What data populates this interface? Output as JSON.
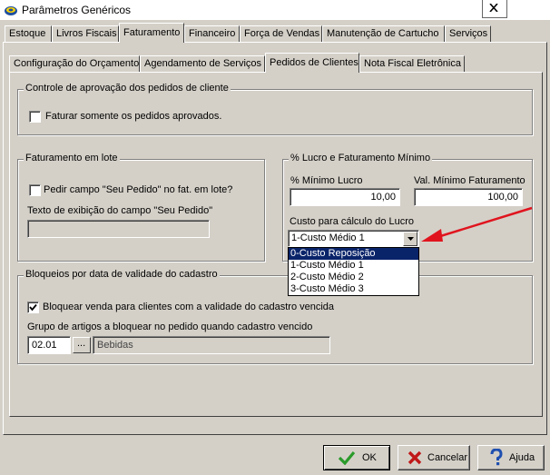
{
  "window": {
    "title": "Parâmetros Genéricos",
    "close_glyph": "X",
    "icon": "app-icon"
  },
  "main_tabs": [
    {
      "label": "Estoque"
    },
    {
      "label": "Livros Fiscais"
    },
    {
      "label": "Faturamento"
    },
    {
      "label": "Financeiro"
    },
    {
      "label": "Força de Vendas"
    },
    {
      "label": "Manutenção de Cartucho"
    },
    {
      "label": "Serviços"
    }
  ],
  "sub_tabs": [
    {
      "label": "Configuração do Orçamento"
    },
    {
      "label": "Agendamento de Serviços"
    },
    {
      "label": "Pedidos de Clientes"
    },
    {
      "label": "Nota Fiscal Eletrônica"
    }
  ],
  "approval_group": {
    "title": "Controle de aprovação dos pedidos de cliente",
    "checkbox_label": "Faturar somente os pedidos aprovados.",
    "checked": false
  },
  "batch_group": {
    "title": "Faturamento em lote",
    "checkbox_label": "Pedir campo \"Seu Pedido\" no fat. em lote?",
    "checked": false,
    "text_label": "Texto de exibição do campo \"Seu Pedido\"",
    "text_value": ""
  },
  "profit_group": {
    "title": "% Lucro e Faturamento Mínimo",
    "min_profit_label": "% Mínimo Lucro",
    "min_profit_value": "10,00",
    "min_billing_label": "Val. Mínimo Faturamento",
    "min_billing_value": "100,00",
    "cost_label": "Custo para cálculo do Lucro",
    "cost_selected": "1-Custo Médio 1",
    "cost_options": [
      "0-Custo Reposição",
      "1-Custo Médio 1",
      "2-Custo Médio 2",
      "3-Custo Médio 3"
    ],
    "highlighted_option_index": 0
  },
  "block_group": {
    "title": "Bloqueios por data de validade do cadastro",
    "checkbox_label": "Bloquear venda para clientes com a validade do cadastro vencida",
    "checked": true,
    "group_label": "Grupo de artigos a bloquear no pedido quando cadastro vencido",
    "group_code": "02.01",
    "browse_label": "...",
    "group_description": "Bebidas"
  },
  "buttons": {
    "ok": "OK",
    "cancel": "Cancelar",
    "help": "Ajuda"
  },
  "colors": {
    "window_bg": "#d4d0c8",
    "selection": "#0a246a",
    "annotation_arrow": "#e0141e"
  }
}
